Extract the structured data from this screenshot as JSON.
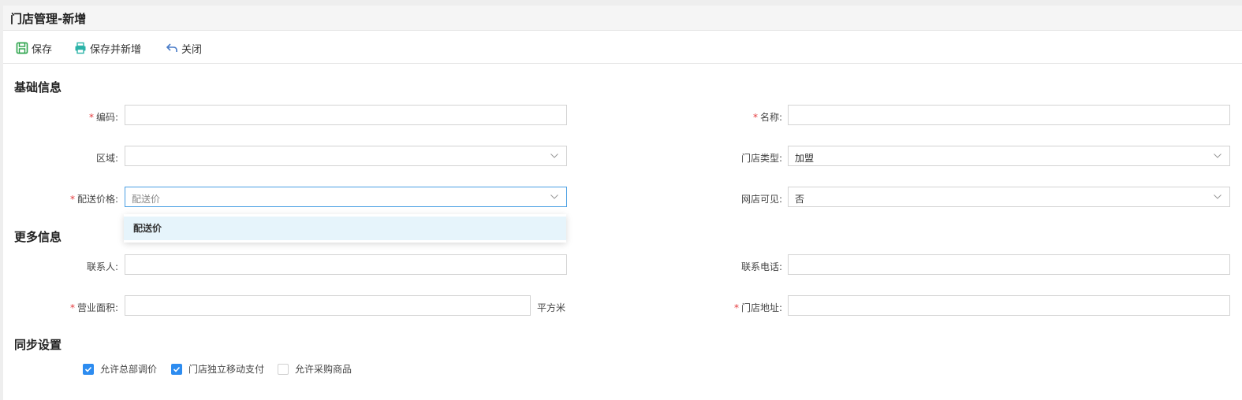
{
  "page": {
    "title": "门店管理-新增"
  },
  "toolbar": {
    "save_label": "保存",
    "save_add_label": "保存并新增",
    "close_label": "关闭",
    "colors": {
      "save_icon": "#2aa34a",
      "print_icon": "#2bb3a8",
      "close_icon": "#4a7cc8"
    }
  },
  "sections": {
    "basic": "基础信息",
    "more": "更多信息",
    "sync": "同步设置"
  },
  "form": {
    "code": {
      "label": "编码:",
      "required": "*",
      "value": ""
    },
    "name": {
      "label": "名称:",
      "required": "*",
      "value": ""
    },
    "region": {
      "label": "区域:",
      "value": ""
    },
    "store_type": {
      "label": "门店类型:",
      "value": "加盟"
    },
    "delivery_price": {
      "label": "配送价格:",
      "required": "*",
      "placeholder": "配送价"
    },
    "online_visible": {
      "label": "网店可见:",
      "value": "否"
    },
    "contact": {
      "label": "联系人:",
      "value": ""
    },
    "phone": {
      "label": "联系电话:",
      "value": ""
    },
    "area": {
      "label": "营业面积:",
      "required": "*",
      "value": "",
      "unit": "平方米"
    },
    "address": {
      "label": "门店地址:",
      "required": "*",
      "value": ""
    }
  },
  "dropdown": {
    "options": [
      "配送价"
    ]
  },
  "checkboxes": [
    {
      "label": "允许总部调价",
      "checked": true
    },
    {
      "label": "门店独立移动支付",
      "checked": true
    },
    {
      "label": "允许采购商品",
      "checked": false
    }
  ],
  "colors": {
    "accent": "#2d8cf0",
    "required": "#e4393c",
    "focus_border": "#4a9fe3",
    "dropdown_highlight": "#e6f4fb"
  }
}
